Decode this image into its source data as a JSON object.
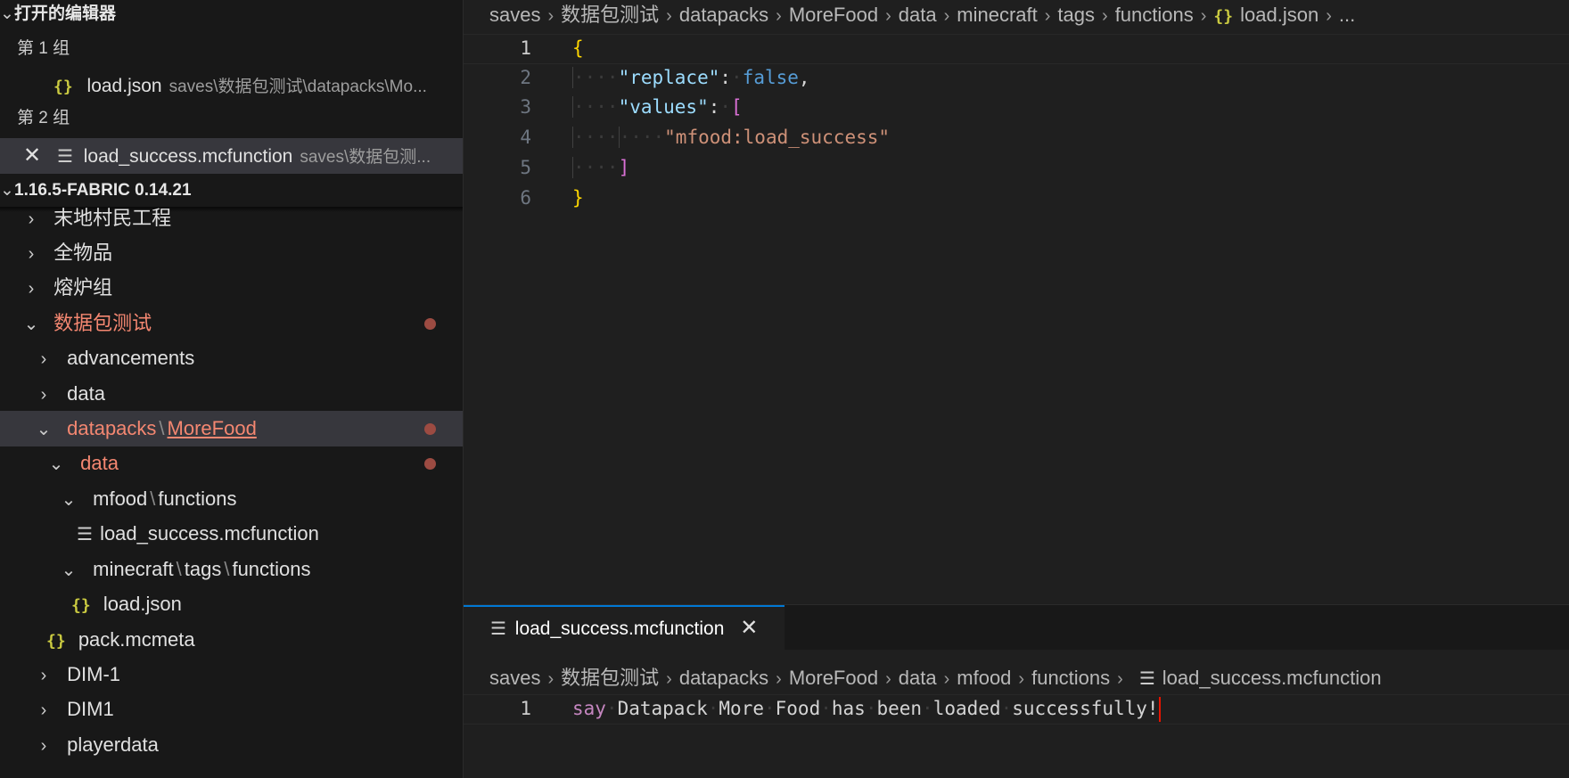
{
  "sidebar": {
    "open_editors_header": "打开的编辑器",
    "group1_label": "第 1 组",
    "group1_file": {
      "icon": "json-braces-icon",
      "name": "load.json",
      "path": "saves\\数据包测试\\datapacks\\Mo..."
    },
    "group2_label": "第 2 组",
    "group2_file": {
      "icon": "lines-icon",
      "name": "load_success.mcfunction",
      "path": "saves\\数据包测..."
    },
    "workspace_header": "1.16.5-FABRIC 0.14.21",
    "tree": {
      "item_1": "末地村民工程",
      "item_2": "全物品",
      "item_3": "熔炉组",
      "item_4": "数据包测试",
      "item_5": "advancements",
      "item_6": "data",
      "item_7_a": "datapacks",
      "item_7_b": "MoreFood",
      "item_8": "data",
      "item_9_a": "mfood",
      "item_9_b": "functions",
      "item_10": "load_success.mcfunction",
      "item_11_a": "minecraft",
      "item_11_b": "tags",
      "item_11_c": "functions",
      "item_12": "load.json",
      "item_13": "pack.mcmeta",
      "item_14": "DIM-1",
      "item_15": "DIM1",
      "item_16": "playerdata"
    }
  },
  "top_editor": {
    "breadcrumb": [
      "saves",
      "数据包测试",
      "datapacks",
      "MoreFood",
      "data",
      "minecraft",
      "tags",
      "functions",
      "load.json",
      "..."
    ],
    "line_numbers": [
      "1",
      "2",
      "3",
      "4",
      "5",
      "6"
    ],
    "code": {
      "l1_open": "{",
      "l2_key": "\"replace\"",
      "l2_colon": ":",
      "l2_val": "false",
      "l2_comma": ",",
      "l3_key": "\"values\"",
      "l3_colon": ":",
      "l3_open": "[",
      "l4_str": "\"mfood:load_success\"",
      "l5_close": "]",
      "l6_close": "}"
    }
  },
  "bottom_editor": {
    "tab_label": "load_success.mcfunction",
    "breadcrumb": [
      "saves",
      "数据包测试",
      "datapacks",
      "MoreFood",
      "data",
      "mfood",
      "functions",
      "load_success.mcfunction"
    ],
    "line_numbers": [
      "1"
    ],
    "code": {
      "cmd": "say",
      "words": [
        "Datapack",
        "More",
        "Food",
        "has",
        "been",
        "loaded",
        "successfully!"
      ]
    }
  },
  "colors": {
    "accent": "#0078d4",
    "modified": "#f48771",
    "json_icon": "#cbcb41"
  }
}
